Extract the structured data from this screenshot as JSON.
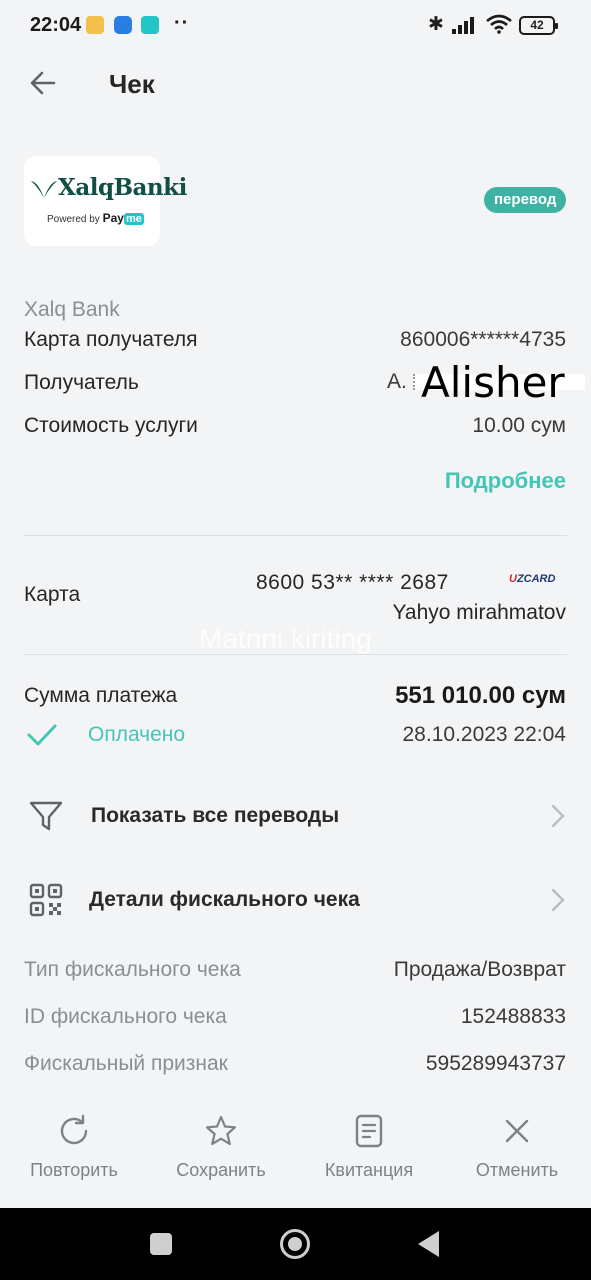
{
  "status_bar": {
    "time": "22:04",
    "dots": "··",
    "battery": "42"
  },
  "header": {
    "title": "Чек"
  },
  "merchant": {
    "logo_text": "XalqBanki",
    "powered_by": "Powered by",
    "pay": "Pay",
    "me": "me",
    "badge": "перевод",
    "provider": "Xalq Bank"
  },
  "details": {
    "recipient_card_label": "Карта получателя",
    "recipient_card_value": "860006******4735",
    "recipient_label": "Получатель",
    "recipient_value": "А.",
    "recipient_overlay": "Alisher",
    "cost_label": "Стоимость услуги",
    "cost_value": "10.00 сум",
    "more_link": "Подробнее"
  },
  "card": {
    "label": "Карта",
    "number": "8600 53** **** 2687",
    "brand_u": "U",
    "brand_rest": "ZCARD",
    "holder": "Yahyo mirahmatov",
    "watermark": "Matnni kiriting"
  },
  "payment": {
    "sum_label": "Сумма платежа",
    "sum_value": "551 010.00 сум",
    "status": "Оплачено",
    "datetime": "28.10.2023 22:04",
    "status_color": "#44c6b5"
  },
  "actions": {
    "show_transfers": "Показать все переводы",
    "fiscal_details": "Детали фискального чека"
  },
  "fiscal": [
    {
      "label": "Тип фискального чека",
      "value": "Продажа/Возврат"
    },
    {
      "label": "ID фискального чека",
      "value": "152488833"
    },
    {
      "label": "Фискальный признак",
      "value": "595289943737"
    }
  ],
  "bottom_bar": {
    "repeat": "Повторить",
    "save": "Сохранить",
    "receipt": "Квитанция",
    "cancel": "Отменить"
  },
  "colors": {
    "accent": "#44c6b5",
    "badge": "#3fb2a5",
    "background": "#f3f4f6"
  }
}
